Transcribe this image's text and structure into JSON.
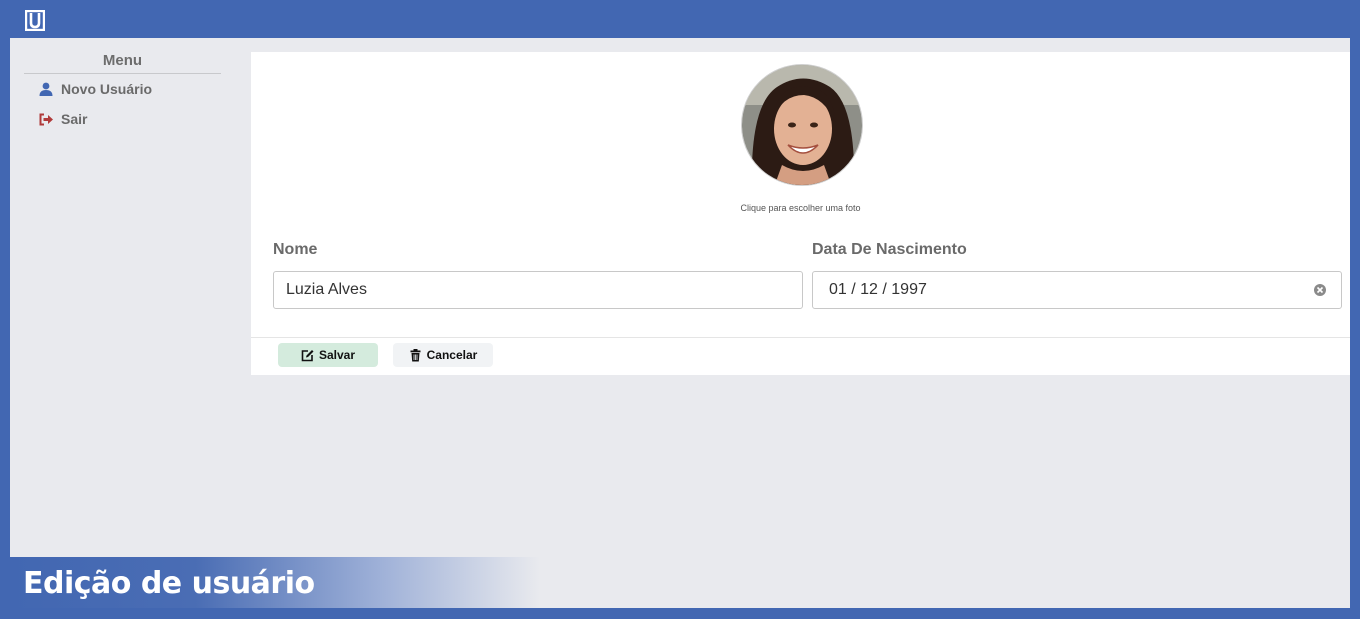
{
  "app": {
    "logo_icon": "u-logo-icon",
    "accent_color": "#4267b2"
  },
  "sidebar": {
    "title": "Menu",
    "items": [
      {
        "label": "Novo Usuário",
        "icon": "user-icon",
        "color": "#4267b2"
      },
      {
        "label": "Sair",
        "icon": "sign-out-icon",
        "color": "#b03a3a"
      }
    ]
  },
  "form": {
    "photo_hint": "Clique para escolher uma foto",
    "name_label": "Nome",
    "name_value": "Luzia Alves",
    "birth_label": "Data De Nascimento",
    "birth_value": "01 / 12 / 1997"
  },
  "actions": {
    "save_label": "Salvar",
    "save_icon": "edit-icon",
    "cancel_label": "Cancelar",
    "cancel_icon": "trash-icon"
  },
  "caption": {
    "text": "Edição de usuário"
  }
}
